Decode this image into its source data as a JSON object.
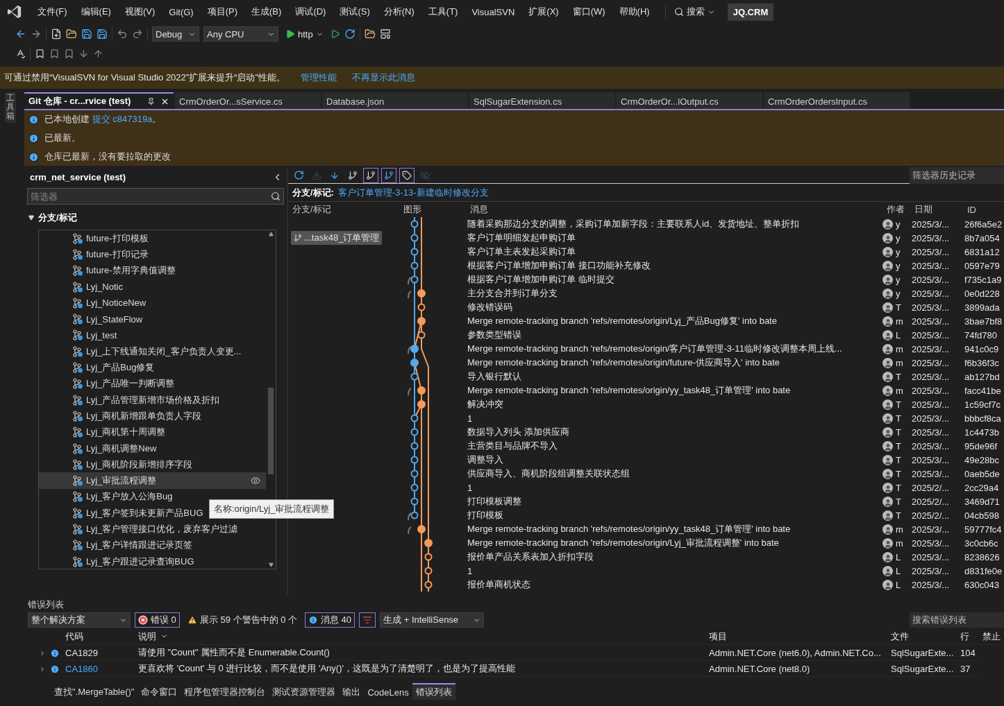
{
  "menu_bar": {
    "items": [
      "文件(F)",
      "编辑(E)",
      "视图(V)",
      "Git(G)",
      "项目(P)",
      "生成(B)",
      "调试(D)",
      "测试(S)",
      "分析(N)",
      "工具(T)",
      "VisualSVN",
      "扩展(X)",
      "窗口(W)",
      "帮助(H)"
    ],
    "search": "搜索",
    "solution_badge": "JQ.CRM"
  },
  "toolbar": {
    "configuration": "Debug",
    "platform": "Any CPU",
    "run_target": "http"
  },
  "notification_bar": {
    "text": "可通过禁用“VisualSVN for Visual Studio 2022”扩展来提升“启动”性能。",
    "links": [
      "管理性能",
      "不再显示此消息"
    ]
  },
  "toolbox_strip": {
    "label": "工具箱"
  },
  "document_tabs": [
    {
      "label": "Git 仓库 - cr...rvice (test)",
      "selected": true
    },
    {
      "label": "CrmOrderOr...sService.cs",
      "selected": false
    },
    {
      "label": "Database.json",
      "selected": false
    },
    {
      "label": "SqlSugarExtension.cs",
      "selected": false
    },
    {
      "label": "CrmOrderOr...lOutput.cs",
      "selected": false
    },
    {
      "label": "CrmOrderOrdersInput.cs",
      "selected": false
    }
  ],
  "info_messages": [
    {
      "text": "已本地创建 ",
      "link": "提交 c847319a",
      "suffix": "。"
    },
    {
      "text": "已最新。"
    },
    {
      "text": "仓库已最新，没有要拉取的更改"
    }
  ],
  "repository_panel": {
    "title": "crm_net_service (test)",
    "filter_placeholder": "筛选器",
    "section": "分支/标记",
    "expanded": true,
    "branches": [
      {
        "name": "future-打印模板",
        "selected": false
      },
      {
        "name": "future-打印记录",
        "selected": false
      },
      {
        "name": "future-禁用字典值调整",
        "selected": false
      },
      {
        "name": "Lyj_Notic",
        "selected": false
      },
      {
        "name": "Lyj_NoticeNew",
        "selected": false
      },
      {
        "name": "Lyj_StateFlow",
        "selected": false
      },
      {
        "name": "Lyj_test",
        "selected": false
      },
      {
        "name": "Lyj_上下线通知关闭_客户负责人变更...",
        "selected": false
      },
      {
        "name": "Lyj_产品Bug修复",
        "selected": false
      },
      {
        "name": "Lyj_产品唯一判断调整",
        "selected": false
      },
      {
        "name": "Lyj_产品管理新增市场价格及折扣",
        "selected": false
      },
      {
        "name": "Lyj_商机新增跟单负责人字段",
        "selected": false
      },
      {
        "name": "Lyj_商机第十周调整",
        "selected": false
      },
      {
        "name": "Lyj_商机调整New",
        "selected": false
      },
      {
        "name": "Lyj_商机阶段新增排序字段",
        "selected": false
      },
      {
        "name": "Lyj_审批流程调整",
        "selected": true
      },
      {
        "name": "Lyj_客户放入公海Bug",
        "selected": false
      },
      {
        "name": "Lyj_客户签到未更新产品BUG",
        "selected": false
      },
      {
        "name": "Lyj_客户管理接口优化，废弃客户过滤",
        "selected": false
      },
      {
        "name": "Lyj_客户详情跟进记录页签",
        "selected": false
      },
      {
        "name": "Lyj_客户跟进记录查询BUG",
        "selected": false
      }
    ],
    "tooltip": "名称:origin/Lyj_审批流程调整"
  },
  "history_panel": {
    "toolbar": [
      {
        "kind": "refresh",
        "selected": false,
        "disabled": false
      },
      {
        "kind": "fetch",
        "selected": false,
        "disabled": true
      },
      {
        "kind": "pull",
        "selected": false,
        "disabled": false
      },
      {
        "kind": "graph",
        "selected": false,
        "disabled": false
      },
      {
        "kind": "local-branches",
        "selected": true,
        "disabled": false
      },
      {
        "kind": "remote-branches",
        "selected": true,
        "disabled": false
      },
      {
        "kind": "tags",
        "selected": true,
        "disabled": false
      },
      {
        "kind": "hide",
        "selected": false,
        "disabled": true
      }
    ],
    "filter_history": "筛选器历史记录",
    "branch_label": "分支/标记:",
    "branch_link": "客户订单管理-3-13-新建临时修改分支",
    "columns": [
      "分支/标记",
      "图形",
      "消息",
      "作者",
      "日期",
      "ID"
    ],
    "commits": [
      {
        "message": "随着采购那边分支的调整，采购订单加新字段：主要联系人id、发货地址、整单折扣",
        "author": "y",
        "date": "2025/3/...",
        "id": "26f6a5e2"
      },
      {
        "branch_tag": "...task48_订单管理",
        "message": "客户订单明细发起申购订单",
        "author": "y",
        "date": "2025/3/...",
        "id": "8b7a054"
      },
      {
        "message": "客户订单主表发起采购订单",
        "author": "y",
        "date": "2025/3/...",
        "id": "6831a12"
      },
      {
        "message": "根据客户订单增加申购订单 接口功能补充修改",
        "author": "y",
        "date": "2025/3/...",
        "id": "0597e79"
      },
      {
        "message": "根据客户订单增加申购订单  临时提交",
        "author": "y",
        "date": "2025/3/...",
        "id": "f735c1a9"
      },
      {
        "message": "主分支合并到订单分支",
        "author": "y",
        "date": "2025/3/...",
        "id": "0e0d228"
      },
      {
        "message": "修改错误码",
        "author": "T",
        "date": "2025/3/...",
        "id": "3899ada"
      },
      {
        "message": "Merge remote-tracking branch 'refs/remotes/origin/Lyj_产品Bug修复' into bate",
        "author": "m",
        "date": "2025/3/...",
        "id": "3bae7bf8"
      },
      {
        "message": "参数类型错误",
        "author": "L",
        "date": "2025/3/...",
        "id": "74fd780"
      },
      {
        "message": "Merge remote-tracking branch 'refs/remotes/origin/客户订单管理-3-11临时修改调整本周上线...",
        "author": "m",
        "date": "2025/3/...",
        "id": "941c0c9"
      },
      {
        "message": "Merge remote-tracking branch 'refs/remotes/origin/future-供应商导入' into bate",
        "author": "m",
        "date": "2025/3/...",
        "id": "f6b36f3c"
      },
      {
        "message": "导入银行默认",
        "author": "T",
        "date": "2025/3/...",
        "id": "ab127bd"
      },
      {
        "message": "Merge remote-tracking branch 'refs/remotes/origin/yy_task48_订单管理' into bate",
        "author": "m",
        "date": "2025/3/...",
        "id": "facc41be"
      },
      {
        "message": "解决冲突",
        "author": "T",
        "date": "2025/3/...",
        "id": "1c59cf7c"
      },
      {
        "message": "1",
        "author": "T",
        "date": "2025/3/...",
        "id": "bbbcf8ca"
      },
      {
        "message": "数据导入列头 添加供应商",
        "author": "T",
        "date": "2025/3/...",
        "id": "1c4473b"
      },
      {
        "message": "主营类目与品牌不导入",
        "author": "T",
        "date": "2025/3/...",
        "id": "95de96f"
      },
      {
        "message": "调整导入",
        "author": "T",
        "date": "2025/3/...",
        "id": "49e28bc"
      },
      {
        "message": "供应商导入、商机阶段组调整关联状态组",
        "author": "T",
        "date": "2025/3/...",
        "id": "0aeb5de"
      },
      {
        "message": "1",
        "author": "T",
        "date": "2025/2/...",
        "id": "2cc29a4"
      },
      {
        "message": "打印模板调整",
        "author": "T",
        "date": "2025/2/...",
        "id": "3469d71"
      },
      {
        "message": "打印模板",
        "author": "T",
        "date": "2025/2/...",
        "id": "04cb598"
      },
      {
        "message": "Merge remote-tracking branch 'refs/remotes/origin/yy_task48_订单管理' into bate",
        "author": "m",
        "date": "2025/3/...",
        "id": "59777fc4"
      },
      {
        "message": "Merge remote-tracking branch 'refs/remotes/origin/Lyj_审批流程调整' into bate",
        "author": "m",
        "date": "2025/3/...",
        "id": "3c0cb6c"
      },
      {
        "message": "报价单产品关系表加入折扣字段",
        "author": "L",
        "date": "2025/3/...",
        "id": "8238626"
      },
      {
        "message": "1",
        "author": "L",
        "date": "2025/3/...",
        "id": "d831fe0e"
      },
      {
        "message": "报价单商机状态",
        "author": "L",
        "date": "2025/3/...",
        "id": "630c043"
      }
    ]
  },
  "error_list": {
    "title": "错误列表",
    "scope": "整个解决方案",
    "filters": [
      {
        "kind": "errors",
        "label": "错误 0",
        "selected": true
      },
      {
        "kind": "warnings",
        "label": "展示 59 个警告中的 0 个",
        "selected": false
      },
      {
        "kind": "messages",
        "label": "消息 40",
        "selected": true
      },
      {
        "kind": "filter",
        "selected": true
      }
    ],
    "source": "生成 + IntelliSense",
    "search_placeholder": "搜索错误列表",
    "columns": [
      "代码",
      "说明",
      "项目",
      "文件",
      "行",
      "禁止"
    ],
    "rows": [
      {
        "code": "CA1829",
        "link": false,
        "description": "请使用 \"Count\" 属性而不是 Enumerable.Count()",
        "project": "Admin.NET.Core (net6.0), Admin.NET.Co...",
        "file": "SqlSugarExte...",
        "line": "104"
      },
      {
        "code": "CA1860",
        "link": true,
        "description": "更喜欢将 'Count' 与 0 进行比较，而不是使用 'Any()'，这既是为了清楚明了，也是为了提高性能",
        "project": "Admin.NET.Core (net8.0)",
        "file": "SqlSugarExte...",
        "line": "37"
      }
    ]
  },
  "bottom_tabs": [
    {
      "label": "查找\".MergeTable()\"",
      "selected": false
    },
    {
      "label": "命令窗口",
      "selected": false
    },
    {
      "label": "程序包管理器控制台",
      "selected": false
    },
    {
      "label": "测试资源管理器",
      "selected": false
    },
    {
      "label": "输出",
      "selected": false
    },
    {
      "label": "CodeLens",
      "selected": false
    },
    {
      "label": "错误列表",
      "selected": true
    }
  ]
}
